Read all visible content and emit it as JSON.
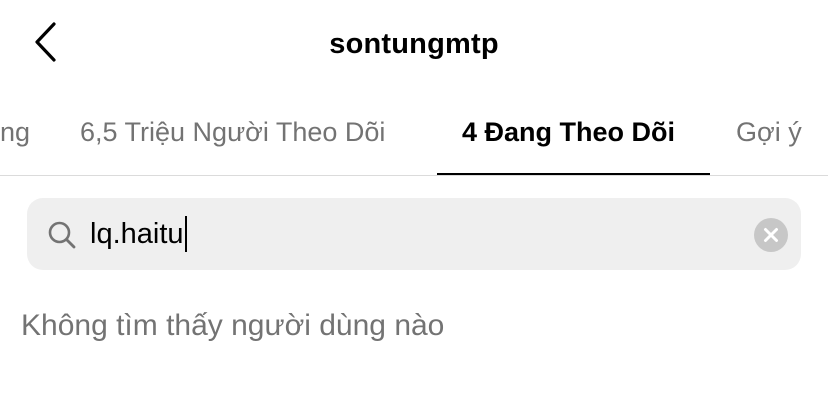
{
  "header": {
    "title": "sontungmtp",
    "back_icon": "chevron-left-icon"
  },
  "tabs": [
    {
      "label": "ng",
      "active": false
    },
    {
      "label": "6,5 Triệu Người Theo Dõi",
      "active": false
    },
    {
      "label": "4 Đang Theo Dõi",
      "active": true
    },
    {
      "label": "Gợi ý",
      "active": false
    }
  ],
  "search": {
    "value": "lq.haitu",
    "icon": "search-icon",
    "clear_icon": "clear-icon"
  },
  "results": {
    "empty_message": "Không tìm thấy người dùng nào"
  },
  "colors": {
    "text_primary": "#000000",
    "text_secondary": "#737373",
    "search_background": "#efefef",
    "divider": "#dbdbdb"
  }
}
